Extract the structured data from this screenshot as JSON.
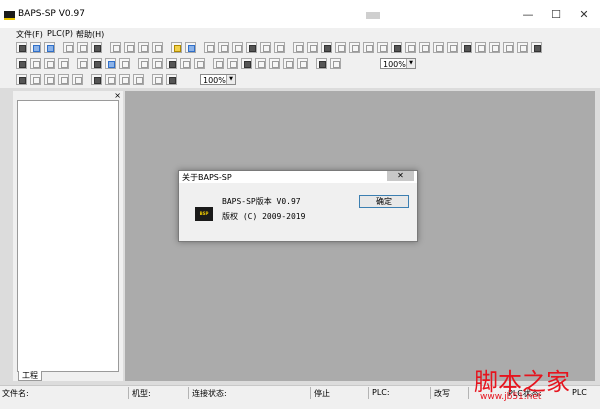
{
  "window": {
    "title": "BAPS-SP V0.97",
    "controls": {
      "minimize": "—",
      "maximize": "☐",
      "close": "✕"
    }
  },
  "menu": [
    {
      "label": "文件(F)"
    },
    {
      "label": "PLC(P)"
    },
    {
      "label": "帮助(H)"
    }
  ],
  "toolbars": {
    "row1": {
      "icons": [
        "new-icon",
        "open-icon",
        "save-icon",
        "print-icon",
        "cut-icon",
        "copy-icon",
        "paste-icon",
        "undo-icon",
        "redo-icon",
        "find-icon",
        "bulb-icon",
        "monitor-icon",
        "ladder-icon",
        "contact-icon",
        "coil-icon",
        "timer-icon",
        "counter-icon",
        "function-icon",
        "arrow-icon",
        "compile-icon",
        "download-icon",
        "upload-icon",
        "run-icon",
        "stop-icon",
        "online-icon",
        "offline-icon",
        "device-icon",
        "table-icon",
        "graph-icon",
        "option-icon",
        "tool-icon",
        "ld-icon",
        "il-icon",
        "sfc-icon",
        "fbd-icon",
        "help-icon"
      ]
    },
    "row2": {
      "icons": [
        "insert-row-icon",
        "delete-row-icon",
        "insert-col-icon",
        "delete-col-icon",
        "h-line-icon",
        "v-line-icon",
        "open-contact-icon",
        "close-contact-icon",
        "rise-icon",
        "fall-icon",
        "set-icon",
        "reset-icon",
        "output-icon",
        "mov-icon",
        "cmp-icon",
        "add-icon",
        "sub-icon",
        "mul-icon",
        "div-icon",
        "comment-icon",
        "zoom-in-icon",
        "zoom-out-icon"
      ],
      "zoom": "100%"
    },
    "row3": {
      "icons": [
        "step-icon",
        "transition-icon",
        "branch-icon",
        "jump-icon",
        "end-icon",
        "block-icon",
        "link-icon",
        "var-icon",
        "param-icon",
        "zoom-in-icon",
        "zoom-out-icon"
      ],
      "zoom": "100%"
    }
  },
  "panel": {
    "close": "×",
    "tab": "工程"
  },
  "status": {
    "file": "文件名:",
    "model": "机型:",
    "connection": "连接状态:",
    "state": "停止",
    "plc": "PLC:",
    "mode": "改写",
    "plc_status": "PLC状态:",
    "plc_end": "PLC"
  },
  "dialog": {
    "title": "关于BAPS-SP",
    "close": "✕",
    "logo_text": "BSP",
    "line1": "BAPS-SP版本 V0.97",
    "line2": "版权 (C) 2009-2019",
    "ok": "确定"
  },
  "watermark": {
    "main": "脚本之家",
    "url": "www.jb51.net"
  },
  "colors": {
    "workspace": "#ababab",
    "chrome": "#f0f0f0",
    "logo_yellow": "#e8c400",
    "watermark_red": "#e6141e"
  }
}
